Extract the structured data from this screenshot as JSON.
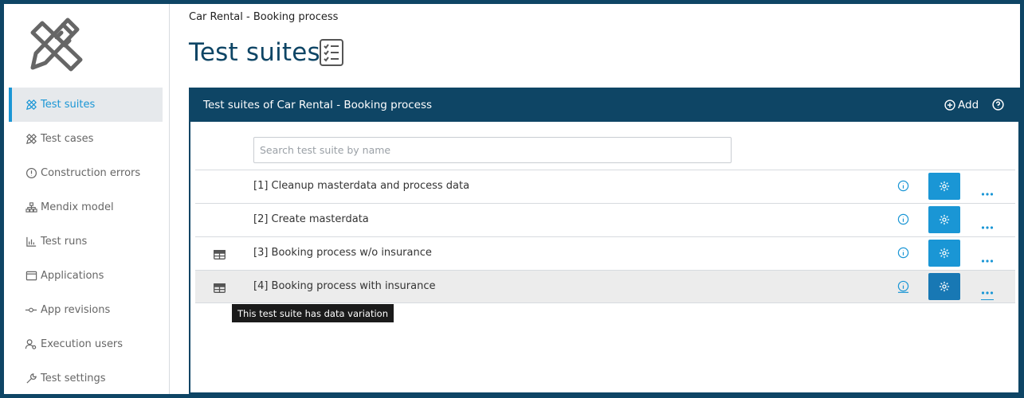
{
  "sidebar": {
    "items": [
      {
        "label": "Test suites",
        "icon": "tools-icon",
        "active": true
      },
      {
        "label": "Test cases",
        "icon": "tools-icon"
      },
      {
        "label": "Construction errors",
        "icon": "alert-circle-icon"
      },
      {
        "label": "Mendix model",
        "icon": "hierarchy-icon"
      },
      {
        "label": "Test runs",
        "icon": "bar-chart-icon"
      },
      {
        "label": "Applications",
        "icon": "calendar-window-icon"
      },
      {
        "label": "App revisions",
        "icon": "commit-icon"
      },
      {
        "label": "Execution users",
        "icon": "user-settings-icon"
      },
      {
        "label": "Test settings",
        "icon": "wrench-icon"
      }
    ]
  },
  "header": {
    "breadcrumb": "Car Rental - Booking process",
    "title": "Test suites"
  },
  "panel": {
    "title": "Test suites of Car Rental - Booking process",
    "add_label": "Add"
  },
  "search": {
    "placeholder": "Search test suite by name",
    "value": ""
  },
  "suites": [
    {
      "name": "[1] Cleanup masterdata and process data",
      "data_variation": false
    },
    {
      "name": "[2] Create masterdata",
      "data_variation": false
    },
    {
      "name": "[3] Booking process w/o insurance",
      "data_variation": true
    },
    {
      "name": "[4] Booking process with insurance",
      "data_variation": true
    }
  ],
  "tooltip": "This test suite has data variation",
  "colors": {
    "brand": "#0e4565",
    "accent": "#1a96d5",
    "accent_dark": "#1878b4"
  }
}
